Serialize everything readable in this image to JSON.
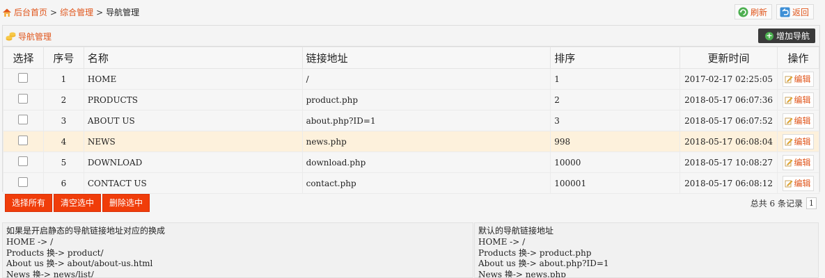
{
  "breadcrumb": {
    "home": "后台首页",
    "section": "综合管理",
    "current": "导航管理",
    "sep": ">"
  },
  "top_buttons": {
    "refresh": "刷新",
    "back": "返回"
  },
  "panel": {
    "title": "导航管理",
    "add_label": "增加导航"
  },
  "table": {
    "headers": [
      "选择",
      "序号",
      "名称",
      "链接地址",
      "排序",
      "更新时间",
      "操作"
    ],
    "edit_label": "编辑",
    "rows": [
      {
        "no": "1",
        "name": "HOME",
        "link": "/",
        "order": "1",
        "updated": "2017-02-17 02:25:05"
      },
      {
        "no": "2",
        "name": "PRODUCTS",
        "link": "product.php",
        "order": "2",
        "updated": "2018-05-17 06:07:36"
      },
      {
        "no": "3",
        "name": "ABOUT US",
        "link": "about.php?ID=1",
        "order": "3",
        "updated": "2018-05-17 06:07:52"
      },
      {
        "no": "4",
        "name": "NEWS",
        "link": "news.php",
        "order": "998",
        "updated": "2018-05-17 06:08:04"
      },
      {
        "no": "5",
        "name": "DOWNLOAD",
        "link": "download.php",
        "order": "10000",
        "updated": "2018-05-17 10:08:27"
      },
      {
        "no": "6",
        "name": "CONTACT US",
        "link": "contact.php",
        "order": "100001",
        "updated": "2018-05-17 06:08:12"
      }
    ]
  },
  "bulk_actions": {
    "select_all": "选择所有",
    "clear": "清空选中",
    "delete": "删除选中"
  },
  "pagination": {
    "total": "总共 6 条记录",
    "page": "1"
  },
  "notes": {
    "static": [
      "如果是开启静态的导航链接地址对应的换成",
      "HOME -> /",
      "Products 换-> product/",
      "About us 换-> about/about-us.html",
      "News 换-> news/list/"
    ],
    "default": [
      "默认的导航链接地址",
      "HOME -> /",
      "Products 换-> product.php",
      "About us 换-> about.php?ID=1",
      "News 换-> news.php"
    ]
  },
  "colors": {
    "accent": "#e0551b",
    "danger": "#f03d0a",
    "highlight_row": "#fdf1dc"
  }
}
